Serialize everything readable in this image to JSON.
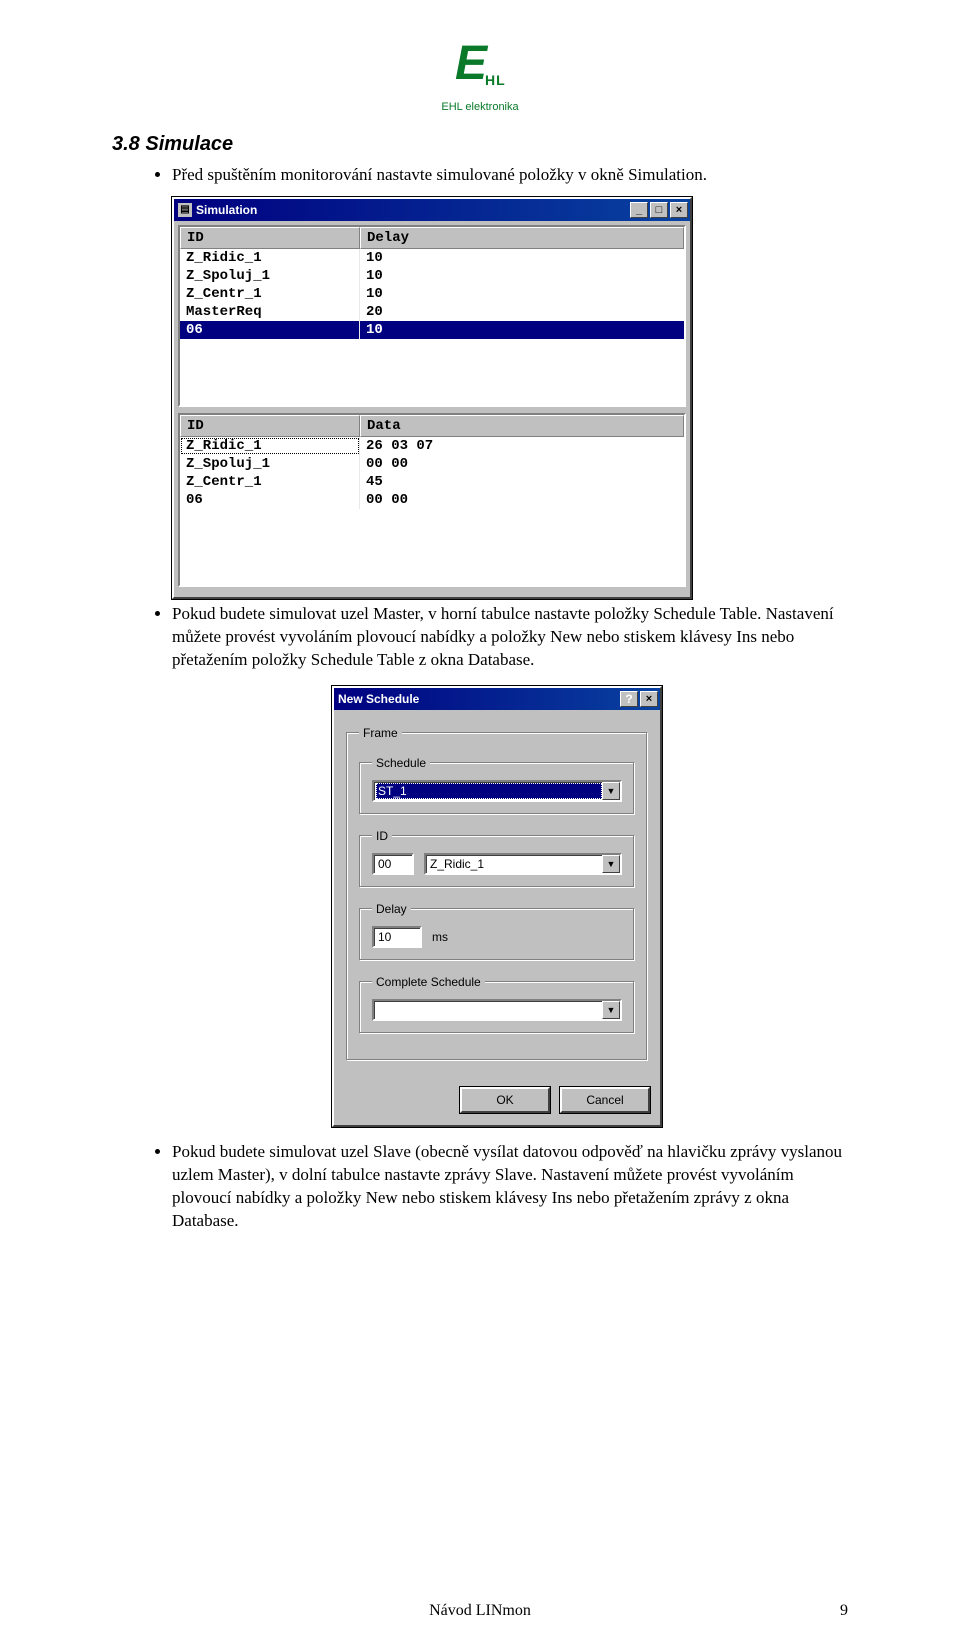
{
  "logo": {
    "big": "E",
    "small": "HL",
    "caption": "EHL elektronika"
  },
  "heading": "3.8  Simulace",
  "bullets": {
    "b1": "Před spuštěním monitorování nastavte simulované položky v okně Simulation.",
    "b2": "Pokud budete simulovat uzel Master, v horní tabulce nastavte položky Schedule Table. Nastavení můžete provést vyvoláním plovoucí nabídky a položky New nebo stiskem klávesy Ins nebo přetažením položky Schedule Table z okna Database.",
    "b3": "Pokud budete simulovat uzel Slave (obecně vysílat datovou odpověď na hlavičku zprávy vyslanou uzlem Master), v dolní tabulce nastavte zprávy Slave. Nastavení můžete provést vyvoláním plovoucí nabídky a položky New nebo stiskem klávesy Ins nebo přetažením zprávy z okna Database."
  },
  "simWindow": {
    "title": "Simulation",
    "minimize": "_",
    "maximize": "□",
    "close": "×",
    "table1": {
      "hId": "ID",
      "hDelay": "Delay",
      "rows": [
        {
          "id": "Z_Ridic_1",
          "delay": "10"
        },
        {
          "id": "Z_Spoluj_1",
          "delay": "10"
        },
        {
          "id": "Z_Centr_1",
          "delay": "10"
        },
        {
          "id": "MasterReq",
          "delay": "20"
        },
        {
          "id": "06",
          "delay": "10"
        }
      ]
    },
    "table2": {
      "hId": "ID",
      "hData": "Data",
      "rows": [
        {
          "id": "Z_Ridic_1",
          "data": "26 03 07"
        },
        {
          "id": "Z_Spoluj_1",
          "data": "00 00"
        },
        {
          "id": "Z_Centr_1",
          "data": "45"
        },
        {
          "id": "06",
          "data": "00 00"
        }
      ]
    }
  },
  "dialog": {
    "title": "New Schedule",
    "help": "?",
    "close": "×",
    "legends": {
      "frame": "Frame",
      "schedule": "Schedule",
      "id": "ID",
      "delay": "Delay",
      "complete": "Complete Schedule"
    },
    "scheduleVal": "ST_1",
    "idNum": "00",
    "idName": "Z_Ridic_1",
    "delayVal": "10",
    "delayUnit": "ms",
    "completeVal": "",
    "ok": "OK",
    "cancel": "Cancel"
  },
  "footer": {
    "center": "Návod LINmon",
    "pageNum": "9"
  }
}
